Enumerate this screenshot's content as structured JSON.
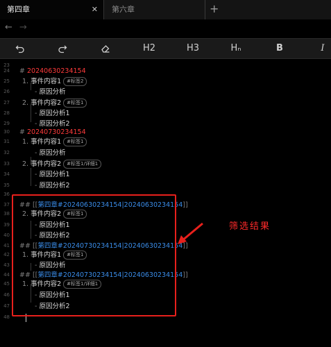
{
  "tabs": [
    {
      "label": "第四章",
      "close": "✕",
      "active": true
    },
    {
      "label": "第六章",
      "active": false
    }
  ],
  "new_tab": "+",
  "nav": {
    "back": "←",
    "forward": "→"
  },
  "toolbar": {
    "h2": "H2",
    "h3": "H3",
    "hn": "Hₙ",
    "bold": "B",
    "italic": "I"
  },
  "editor": {
    "line_numbers": [
      "23",
      "24",
      "25",
      "26",
      "27",
      "28",
      "29",
      "30",
      "31",
      "32",
      "33",
      "34",
      "35",
      "36",
      "37",
      "38",
      "39",
      "40",
      "41",
      "42",
      "43",
      "44",
      "45",
      "46",
      "47",
      "48"
    ],
    "heading_1": {
      "hash": "#",
      "text": "20240630234154"
    },
    "item_1": {
      "num": "1.",
      "text": "事件内容1",
      "tag": "#标签2"
    },
    "reason_1": {
      "dash": "-",
      "text": "原因分析"
    },
    "item_2": {
      "num": "2.",
      "text": "事件内容2",
      "tag": "#标签1"
    },
    "reason_2a": {
      "dash": "-",
      "text": "原因分析1"
    },
    "reason_2b": {
      "dash": "-",
      "text": "原因分析2"
    },
    "heading_2": {
      "hash": "#",
      "text": "20240730234154"
    },
    "item_3": {
      "num": "1.",
      "text": "事件内容1",
      "tag": "#标签1"
    },
    "reason_3": {
      "dash": "-",
      "text": "原因分析"
    },
    "item_4": {
      "num": "2.",
      "text": "事件内容2",
      "tag": "#标签1/详细1"
    },
    "reason_4a": {
      "dash": "-",
      "text": "原因分析1"
    },
    "reason_4b": {
      "dash": "-",
      "text": "原因分析2"
    },
    "result_heading_1": {
      "hash": "##",
      "open": "[[",
      "link": "第四章#20240630234154|20240630234154",
      "close": "]]"
    },
    "result_item_1": {
      "num": "2.",
      "text": "事件内容2",
      "tag": "#标签1"
    },
    "result_reason_1a": {
      "dash": "-",
      "text": "原因分析1"
    },
    "result_reason_1b": {
      "dash": "-",
      "text": "原因分析2"
    },
    "result_heading_2": {
      "hash": "##",
      "open": "[[",
      "link": "第四章#20240730234154|20240630234154",
      "close": "]]"
    },
    "result_item_2": {
      "num": "1.",
      "text": "事件内容1",
      "tag": "#标签1"
    },
    "result_reason_2": {
      "dash": "-",
      "text": "原因分析"
    },
    "result_heading_3": {
      "hash": "##",
      "open": "[[",
      "link": "第四章#20240730234154|20240630234154",
      "close": "]]"
    },
    "result_item_3": {
      "num": "1.",
      "text": "事件内容2",
      "tag": "#标签1/详细1"
    },
    "result_reason_3a": {
      "dash": "-",
      "text": "原因分析1"
    },
    "result_reason_3b": {
      "dash": "-",
      "text": "原因分析2"
    }
  },
  "annotation": {
    "label": "筛选结果",
    "color": "#ff2a2a"
  }
}
